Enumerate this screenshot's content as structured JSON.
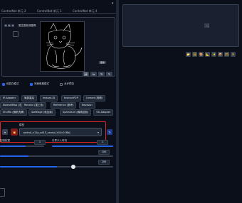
{
  "tabs": [
    "ControlNet 单元 2",
    "ControlNet 单元 3",
    "ControlNet 单元 4"
  ],
  "image_panel": {
    "label": "图生图检测图像",
    "badge": "图像",
    "controls": [
      "↺",
      "↻",
      "✕"
    ],
    "tools": [
      "🖼",
      "⇆",
      "⇅",
      "✎"
    ]
  },
  "options": {
    "enable_label": "启用",
    "low_vram_label": "低显存模式",
    "pixel_perfect_label": "完美像素模式",
    "preview_label": "允许预览"
  },
  "control_types": [
    "IP-Adapter",
    "局部重绘",
    "Instant-ID",
    "InstructP2P",
    "Lineart (线稿)",
    "NormalMap (法线贴图)",
    "Recolor (重上色)",
    "Reference (参考)",
    "Revision",
    "Shuffle (随机洗牌)",
    "SoftEdge (软边缘)",
    "SparseCtrl (稀疏控制)",
    "T2I-Adapter"
  ],
  "model_section": {
    "preprocessor_label": "",
    "preprocessor_value": "",
    "model_label": "模型",
    "model_value": "control_v11p_sd15_canny [d14c016b]",
    "fire_icon": "💥",
    "refresh_icon": "↻"
  },
  "sliders": {
    "weight_label": "控制权重",
    "weight_value": "1",
    "start_label": "引导介入时机",
    "start_value": "0",
    "end_label": "引导终止时机",
    "end_value": "1",
    "low_threshold_value": "100",
    "high_threshold_value": "200"
  },
  "output": {
    "placeholder_icon": "🖼"
  },
  "gallery_tools": [
    "📁",
    "🖼",
    "🎨",
    "📐",
    "✨",
    "📦",
    "🗂",
    "⚙"
  ],
  "colors": {
    "accent": "#2563eb",
    "highlight": "#dc2626",
    "panel": "#0b0f19"
  }
}
